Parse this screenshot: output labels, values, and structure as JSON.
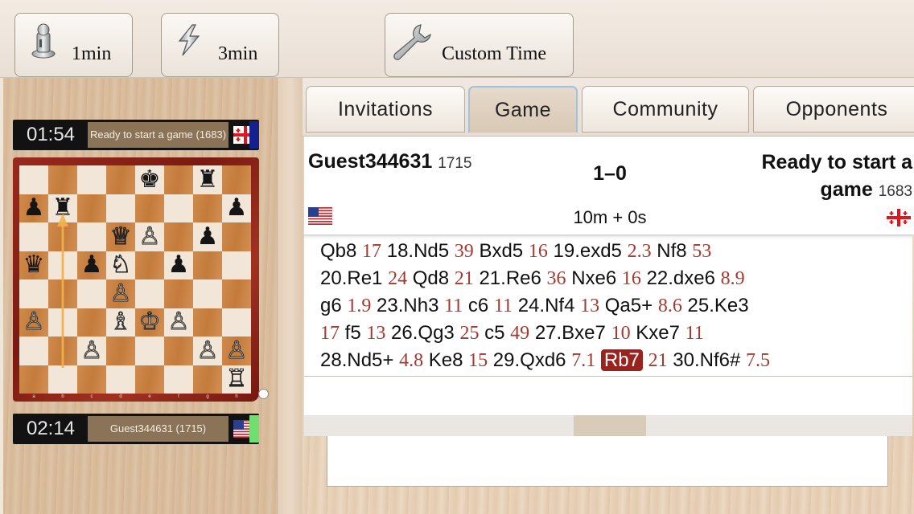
{
  "toolbar": {
    "buttons": [
      {
        "label": "1min",
        "icon": "pawn-icon"
      },
      {
        "label": "3min",
        "icon": "lightning-icon"
      },
      {
        "label": "Custom Time",
        "icon": "wrench-icon"
      }
    ]
  },
  "players": {
    "top": {
      "clock": "01:54",
      "name": "Ready to start a game (1683)",
      "flag": "georgia-flag-icon",
      "indicator_color": "#16208c"
    },
    "bottom": {
      "clock": "02:14",
      "name": "Guest344631 (1715)",
      "flag": "usa-flag-icon",
      "indicator_color": "#6fe06f"
    }
  },
  "board": {
    "ranks": [
      [
        "",
        "",
        "",
        "",
        "♚",
        "",
        "♜",
        ""
      ],
      [
        "♟",
        "♜",
        "",
        "",
        "",
        "",
        "",
        "♟"
      ],
      [
        "",
        "",
        "",
        "♕",
        "♙",
        "",
        "♟",
        ""
      ],
      [
        "♛",
        "",
        "♟",
        "♘",
        "",
        "♟",
        "",
        ""
      ],
      [
        "",
        "",
        "",
        "♙",
        "",
        "",
        "",
        ""
      ],
      [
        "♙",
        "",
        "",
        "♗",
        "♔",
        "♙",
        "",
        ""
      ],
      [
        "",
        "",
        "♙",
        "",
        "",
        "",
        "♙",
        "♙"
      ],
      [
        "",
        "",
        "",
        "",
        "",
        "",
        "",
        "♖"
      ]
    ],
    "files": [
      "a",
      "b",
      "c",
      "d",
      "e",
      "f",
      "g",
      "h"
    ],
    "last_move": {
      "from": "b2",
      "to": "b7"
    }
  },
  "tabs": [
    {
      "label": "Invitations",
      "active": false
    },
    {
      "label": "Game",
      "active": true
    },
    {
      "label": "Community",
      "active": false
    },
    {
      "label": "Opponents",
      "active": false
    }
  ],
  "game": {
    "white_name": "Guest344631",
    "white_rating": "1715",
    "black_name_line1": "Ready to start a",
    "black_name_line2": "game",
    "black_rating": "1683",
    "result": "1–0",
    "time_control": "10m + 0s",
    "white_flag": "usa-flag-icon",
    "black_flag": "georgia-flag-icon"
  },
  "moves": [
    {
      "san": "Qb8",
      "t": "17"
    },
    {
      "san": "18.Nd5",
      "t": "39"
    },
    {
      "san": "Bxd5",
      "t": "16"
    },
    {
      "san": "19.exd5",
      "t": "2.3"
    },
    {
      "san": "Nf8",
      "t": "53"
    },
    {
      "san": "20.Re1",
      "t": "24"
    },
    {
      "san": "Qd8",
      "t": "21"
    },
    {
      "san": "21.Re6",
      "t": "36"
    },
    {
      "san": "Nxe6",
      "t": "16"
    },
    {
      "san": "22.dxe6",
      "t": "8.9"
    },
    {
      "san": "g6",
      "t": "1.9"
    },
    {
      "san": "23.Nh3",
      "t": "11"
    },
    {
      "san": "c6",
      "t": "11"
    },
    {
      "san": "24.Nf4",
      "t": "13"
    },
    {
      "san": "Qa5+",
      "t": "8.6"
    },
    {
      "san": "25.Ke3",
      "t": ""
    },
    {
      "san": "",
      "t": "17"
    },
    {
      "san": "f5",
      "t": "13"
    },
    {
      "san": "26.Qg3",
      "t": "25"
    },
    {
      "san": "c5",
      "t": "49"
    },
    {
      "san": "27.Bxe7",
      "t": "10"
    },
    {
      "san": "Kxe7",
      "t": "11"
    },
    {
      "san": "28.Nd5+",
      "t": "4.8"
    },
    {
      "san": "Ke8",
      "t": "15"
    },
    {
      "san": "29.Qxd6",
      "t": "7.1"
    },
    {
      "san": "Rb7",
      "t": "21",
      "highlight": true
    },
    {
      "san": "30.Nf6#",
      "t": "7.5"
    }
  ],
  "move_lines": [
    [
      0,
      5
    ],
    [
      5,
      10
    ],
    [
      10,
      16
    ],
    [
      16,
      22
    ],
    [
      22,
      27
    ]
  ],
  "colors": {
    "move_time": "#a33a30",
    "highlight": "#9b231d",
    "board_frame": "#8c2418"
  }
}
